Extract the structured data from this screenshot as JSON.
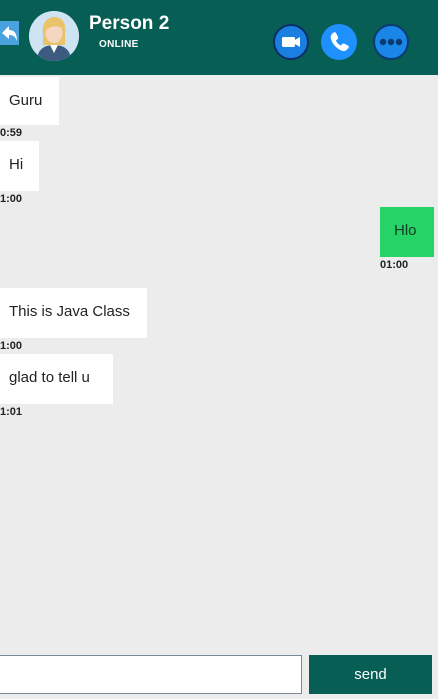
{
  "header": {
    "name": "Person 2",
    "status": "ONLINE",
    "back_icon": "back-arrow-icon",
    "video_icon": "video-camera-icon",
    "call_icon": "phone-icon",
    "more_icon": "more-dots-icon"
  },
  "messages": [
    {
      "text": "Guru",
      "time": "0:59",
      "direction": "in"
    },
    {
      "text": "Hi",
      "time": "1:00",
      "direction": "in"
    },
    {
      "text": "Hlo",
      "time": "01:00",
      "direction": "out"
    },
    {
      "text": "This is Java Class",
      "time": "1:00",
      "direction": "in"
    },
    {
      "text": "glad to tell u",
      "time": "1:01",
      "direction": "in"
    }
  ],
  "composer": {
    "input_value": "",
    "send_label": "send"
  },
  "colors": {
    "header": "#075e54",
    "background": "#ececec",
    "incoming": "#ffffff",
    "outgoing": "#25d366",
    "send_button": "#075e54"
  }
}
